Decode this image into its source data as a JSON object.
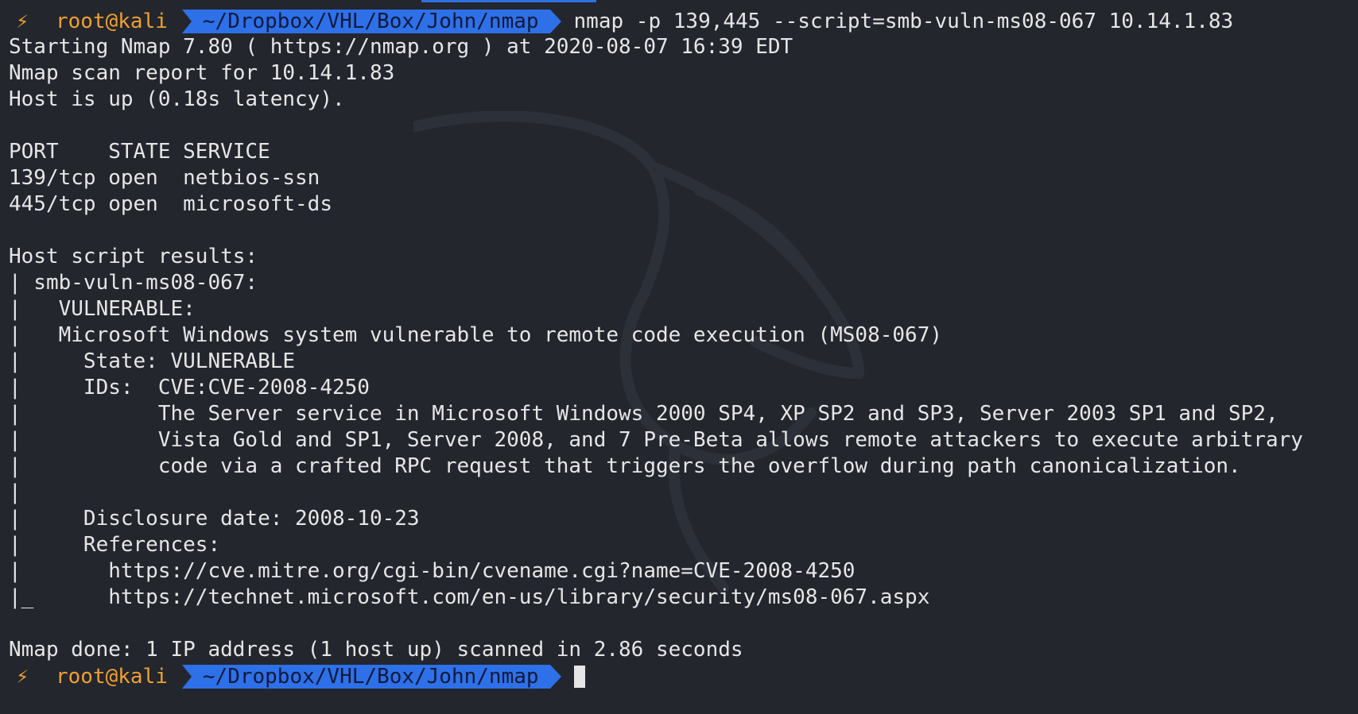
{
  "prompt": {
    "bolt_icon": "⚡",
    "user": "root@kali",
    "path": "~/Dropbox/VHL/Box/John/nmap",
    "command": "nmap -p 139,445 --script=smb-vuln-ms08-067 10.14.1.83"
  },
  "output": [
    "Starting Nmap 7.80 ( https://nmap.org ) at 2020-08-07 16:39 EDT",
    "Nmap scan report for 10.14.1.83",
    "Host is up (0.18s latency).",
    "",
    "PORT    STATE SERVICE",
    "139/tcp open  netbios-ssn",
    "445/tcp open  microsoft-ds",
    "",
    "Host script results:",
    "| smb-vuln-ms08-067:",
    "|   VULNERABLE:",
    "|   Microsoft Windows system vulnerable to remote code execution (MS08-067)",
    "|     State: VULNERABLE",
    "|     IDs:  CVE:CVE-2008-4250",
    "|           The Server service in Microsoft Windows 2000 SP4, XP SP2 and SP3, Server 2003 SP1 and SP2,",
    "|           Vista Gold and SP1, Server 2008, and 7 Pre-Beta allows remote attackers to execute arbitrary",
    "|           code via a crafted RPC request that triggers the overflow during path canonicalization.",
    "|",
    "|     Disclosure date: 2008-10-23",
    "|     References:",
    "|       https://cve.mitre.org/cgi-bin/cvename.cgi?name=CVE-2008-4250",
    "|_      https://technet.microsoft.com/en-us/library/security/ms08-067.aspx",
    "",
    "Nmap done: 1 IP address (1 host up) scanned in 2.86 seconds"
  ],
  "colors": {
    "background": "#23262d",
    "text": "#e6e6e6",
    "user": "#f0a030",
    "path_bg": "#2e70e8",
    "path_text": "#0f1a3a"
  }
}
